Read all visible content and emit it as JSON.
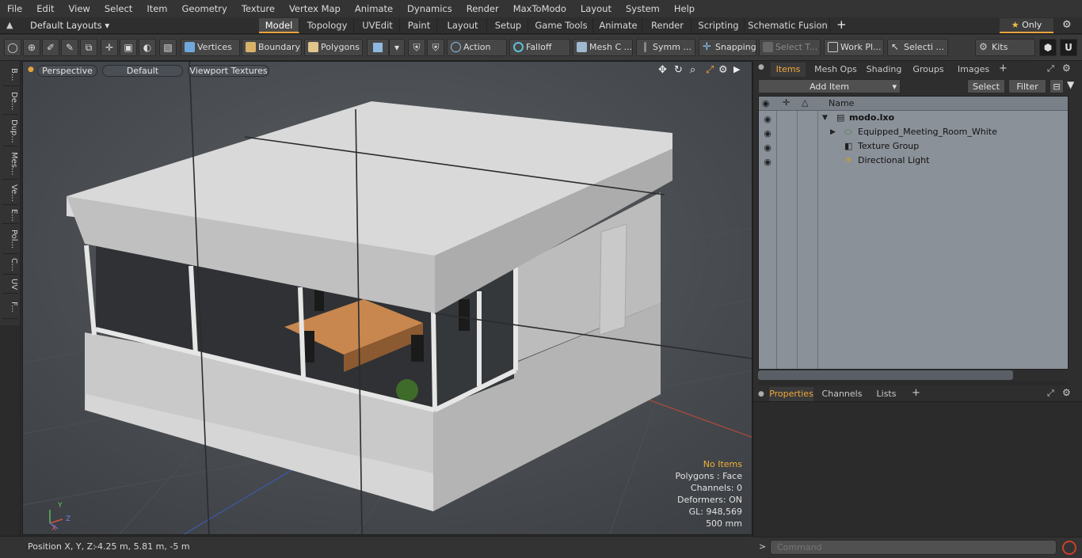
{
  "menu": [
    "File",
    "Edit",
    "View",
    "Select",
    "Item",
    "Geometry",
    "Texture",
    "Vertex Map",
    "Animate",
    "Dynamics",
    "Render",
    "MaxToModo",
    "Layout",
    "System",
    "Help"
  ],
  "layout_bar": {
    "layouts_label": "Default Layouts",
    "tabs": [
      "Model",
      "Topology",
      "UVEdit",
      "Paint",
      "Layout",
      "Setup",
      "Game Tools",
      "Animate",
      "Render",
      "Scripting",
      "Schematic Fusion"
    ],
    "active_tab": "Model",
    "add_label": "+",
    "only_label": "Only"
  },
  "toolbar": {
    "vertices": "Vertices",
    "boundary": "Boundary",
    "polygons": "Polygons",
    "action": "Action",
    "falloff": "Falloff",
    "mesh": "Mesh C ...",
    "symm": "Symm ...",
    "snapping": "Snapping",
    "select_t": "Select T...",
    "work_pl": "Work Pl...",
    "selecti": "Selecti ...",
    "kits": "Kits"
  },
  "left_tabs": [
    "B...",
    "De...",
    "Dup...",
    "Mes...",
    "Ve...",
    "E...",
    "Pol...",
    "C...",
    "UV",
    "F..."
  ],
  "viewport": {
    "view_label": "Perspective",
    "shading_label": "Default",
    "textures_label": "Viewport Textures",
    "info": {
      "selection": "No Items",
      "polygons": "Polygons : Face",
      "channels": "Channels: 0",
      "deformers": "Deformers: ON",
      "gl": "GL: 948,569",
      "scale": "500 mm"
    },
    "axis": {
      "x": "X",
      "y": "Y",
      "z": "Z"
    }
  },
  "status": {
    "position_label": "Position X, Y, Z:",
    "position_value": "-4.25 m, 5.81 m, -5 m"
  },
  "items_panel": {
    "tabs": [
      "Items",
      "Mesh Ops",
      "Shading",
      "Groups",
      "Images"
    ],
    "active_tab": "Items",
    "add_item": "Add Item",
    "select": "Select",
    "filter": "Filter",
    "column_name": "Name",
    "items": [
      {
        "name": "modo.lxo",
        "level": 0
      },
      {
        "name": "Equipped_Meeting_Room_White",
        "level": 1
      },
      {
        "name": "Texture Group",
        "level": 1
      },
      {
        "name": "Directional Light",
        "level": 1
      }
    ]
  },
  "properties_panel": {
    "tabs": [
      "Properties",
      "Channels",
      "Lists"
    ],
    "active_tab": "Properties"
  },
  "command": {
    "placeholder": "Command"
  },
  "colors": {
    "accent": "#e8a33c",
    "viewport_bg": "#4d5155",
    "list_bg": "#8b9199"
  }
}
